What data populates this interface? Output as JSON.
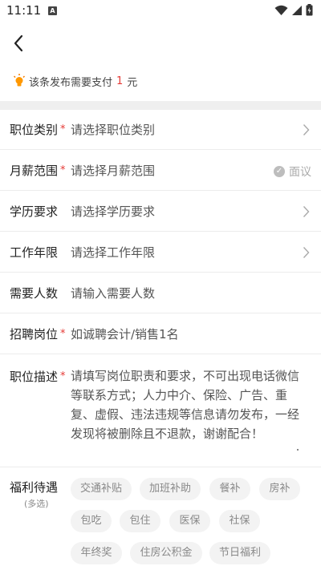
{
  "status_bar": {
    "time": "11:11",
    "app_icon_letter": "A"
  },
  "notice": {
    "prefix": "该条发布需要支付",
    "amount": "1",
    "suffix": "元"
  },
  "fields": {
    "job_category": {
      "label": "职位类别",
      "placeholder": "请选择职位类别",
      "required": "*"
    },
    "salary": {
      "label": "月薪范围",
      "placeholder": "请选择月薪范围",
      "required": "*",
      "negotiable": "面议"
    },
    "education": {
      "label": "学历要求",
      "placeholder": "请选择学历要求"
    },
    "experience": {
      "label": "工作年限",
      "placeholder": "请选择工作年限"
    },
    "headcount": {
      "label": "需要人数",
      "placeholder": "请输入需要人数"
    },
    "position": {
      "label": "招聘岗位",
      "placeholder": "如诚聘会计/销售1名",
      "required": "*"
    },
    "description": {
      "label": "职位描述",
      "placeholder": "请填写岗位职责和要求，不可出现电话微信等联系方式；人力中介、保险、广告、重复、虚假、违法违规等信息请勿发布，一经发现将被删除且不退款，谢谢配合！",
      "required": "*"
    }
  },
  "benefits": {
    "label": "福利待遇",
    "sub_label": "(多选)",
    "options": [
      "交通补贴",
      "加班补助",
      "餐补",
      "房补",
      "包吃",
      "包住",
      "医保",
      "社保",
      "年终奖",
      "住房公积金",
      "节日福利"
    ]
  },
  "colors": {
    "accent_red": "#e53935",
    "chip_bg": "#f3f3f3",
    "band": "#efefef"
  }
}
